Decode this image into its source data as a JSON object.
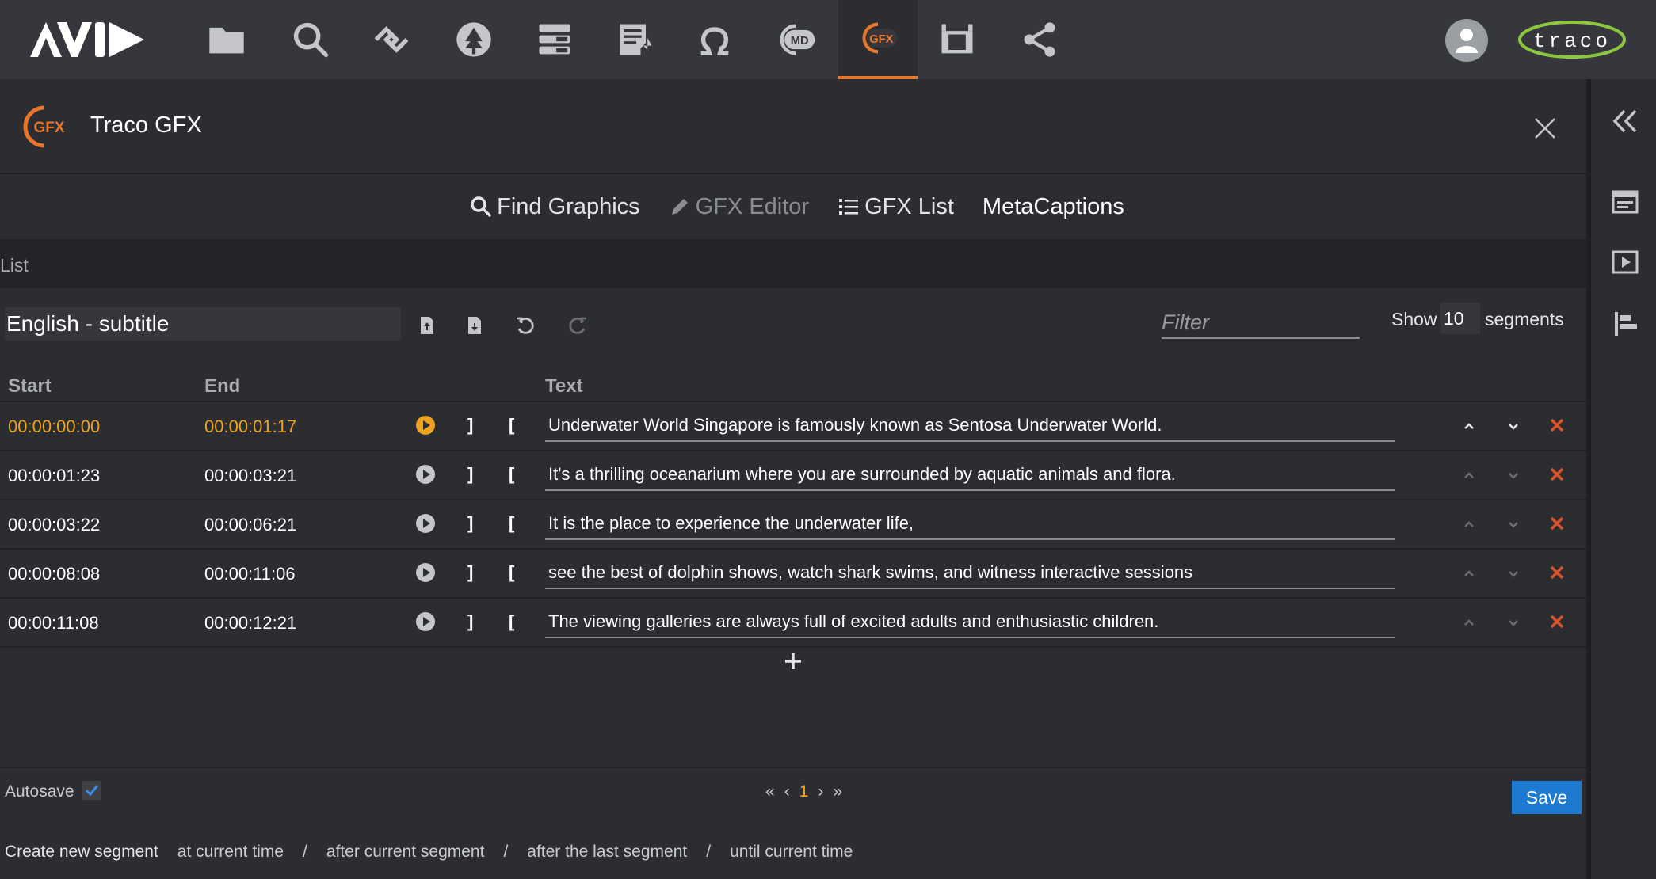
{
  "topbar": {
    "tools": [
      {
        "name": "folder-icon"
      },
      {
        "name": "search-icon"
      },
      {
        "name": "link-icon"
      },
      {
        "name": "tree-icon"
      },
      {
        "name": "stack-icon"
      },
      {
        "name": "notes-icon"
      },
      {
        "name": "omega-icon"
      },
      {
        "name": "md-icon",
        "label": "MD"
      },
      {
        "name": "gfx-icon",
        "label": "GFX"
      },
      {
        "name": "clapper-icon"
      },
      {
        "name": "share-icon"
      }
    ],
    "brand_logo_text": "traco"
  },
  "panel": {
    "title": "Traco GFX",
    "gfx_badge": "GFX"
  },
  "tabs": [
    {
      "label": "Find Graphics",
      "icon": "search-icon"
    },
    {
      "label": "GFX Editor",
      "icon": "pencil-icon"
    },
    {
      "label": "GFX List",
      "icon": "list-icon"
    },
    {
      "label": "MetaCaptions"
    }
  ],
  "list": {
    "section_label": "List",
    "language": "English - subtitle",
    "filter_placeholder": "Filter",
    "show_label": "Show",
    "show_count": "10",
    "segments_label": "segments"
  },
  "table": {
    "headers": {
      "start": "Start",
      "end": "End",
      "text": "Text"
    },
    "rows": [
      {
        "start": "00:00:00:00",
        "end": "00:00:01:17",
        "text": "Underwater World Singapore is famously known as Sentosa Underwater World."
      },
      {
        "start": "00:00:01:23",
        "end": "00:00:03:21",
        "text": "It's a thrilling oceanarium where you are surrounded by aquatic animals and flora."
      },
      {
        "start": "00:00:03:22",
        "end": "00:00:06:21",
        "text": "It is the place to experience the underwater life,"
      },
      {
        "start": "00:00:08:08",
        "end": "00:00:11:06",
        "text": "see the best of dolphin shows, watch shark swims, and witness interactive sessions"
      },
      {
        "start": "00:00:11:08",
        "end": "00:00:12:21",
        "text": "The viewing galleries are always full of excited adults and enthusiastic children."
      }
    ],
    "bracket_out": "]",
    "bracket_in": "["
  },
  "footer": {
    "autosave_label": "Autosave",
    "autosave_checked": true,
    "pager": {
      "first": "«",
      "prev": "‹",
      "current": "1",
      "next": "›",
      "last": "»"
    },
    "save_label": "Save",
    "create_label": "Create new segment",
    "create_options": [
      "at current time",
      "after current segment",
      "after the last segment",
      "until current time"
    ],
    "separator": "/"
  },
  "colors": {
    "accent_orange": "#e8762b",
    "current_time": "#eea320",
    "save_blue": "#1e7ad1",
    "delete_red": "#d9532c"
  }
}
